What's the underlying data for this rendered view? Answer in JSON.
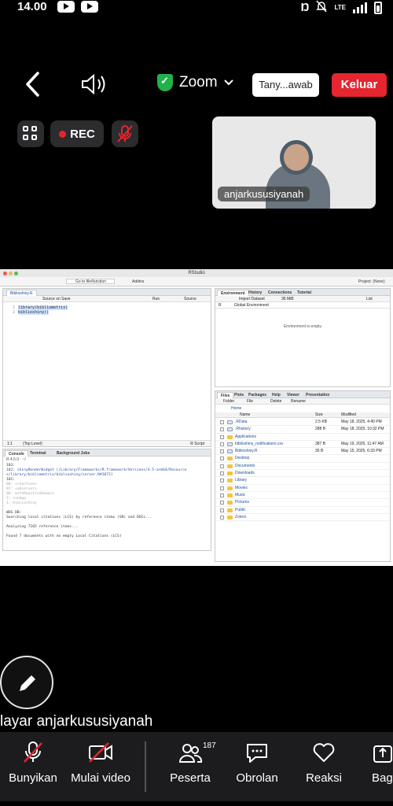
{
  "status_bar": {
    "time": "14.00",
    "network": "LTE"
  },
  "top_bar": {
    "audio_label": "Zoom",
    "ask_button": "Tany...awab",
    "leave_button": "Keluar",
    "rec_label": "REC"
  },
  "video": {
    "participant_name": "anjarkususiyanah"
  },
  "rstudio": {
    "window_title": "RStudio",
    "toolbar": {
      "goto": "Go to file/function",
      "addins": "Addins",
      "project": "Project: (None)"
    },
    "editor": {
      "tab": "Biblioshiny.R",
      "source_on_save": "Source on Save",
      "run": "Run",
      "source": "Source",
      "line_numbers": [
        "1",
        "2"
      ],
      "lines": [
        "library(bibliometrix)",
        "biblioshiny()"
      ],
      "status_pos": "1:1",
      "status_scope": "(Top Level)",
      "status_type": "R Script"
    },
    "console": {
      "tabs": [
        "Console",
        "Terminal",
        "Background Jobs"
      ],
      "path": "R 4.5.0 · ~/",
      "lines": [
        "103:",
        "102: shinyRenderWidget [/Library/Frameworks/R.framework/Versions/4.5-arm64/Resource",
        "s/library/bibliometrix/biblioshiny/server.R#3872]",
        "101:",
        "88: <reactive>",
        "87: <observer>",
        "86: withReactiveDomain",
        "2: runApp",
        "1: biblioshiny",
        "",
        "WOS DB:",
        "Searching local citations (LCS) by reference items (SR) and DOIs...",
        "",
        "Analyzing 7165 reference items...",
        "",
        "Found 7 documents with no empty Local Citations (LCS)"
      ]
    },
    "environment": {
      "tabs": [
        "Environment",
        "History",
        "Connections",
        "Tutorial"
      ],
      "import": "Import Dataset",
      "memory": "36 MiB",
      "list": "List",
      "lang": "R",
      "scope": "Global Environment",
      "empty_msg": "Environment is empty"
    },
    "files": {
      "tabs": [
        "Files",
        "Plots",
        "Packages",
        "Help",
        "Viewer",
        "Presentation"
      ],
      "toolbar": [
        "Folder",
        "File",
        "Delete",
        "Rename"
      ],
      "breadcrumb": "Home",
      "headers": [
        "Name",
        "Size",
        "Modified"
      ],
      "rows": [
        {
          "name": ".RData",
          "size": "2.5 KB",
          "modified": "May 18, 2025, 4:40 PM",
          "folder": false
        },
        {
          "name": ".Rhistory",
          "size": "288 B",
          "modified": "May 18, 2025, 10:32 PM",
          "folder": false
        },
        {
          "name": "Applications",
          "size": "",
          "modified": "",
          "folder": true
        },
        {
          "name": "biblioshiny_notifications.csv",
          "size": "387 B",
          "modified": "May 19, 2025, 11:47 AM",
          "folder": false
        },
        {
          "name": "Biblioshiny.R",
          "size": "35 B",
          "modified": "May 15, 2025, 6:33 PM",
          "folder": false
        },
        {
          "name": "Desktop",
          "size": "",
          "modified": "",
          "folder": true
        },
        {
          "name": "Documents",
          "size": "",
          "modified": "",
          "folder": true
        },
        {
          "name": "Downloads",
          "size": "",
          "modified": "",
          "folder": true
        },
        {
          "name": "Library",
          "size": "",
          "modified": "",
          "folder": true
        },
        {
          "name": "Movies",
          "size": "",
          "modified": "",
          "folder": true
        },
        {
          "name": "Music",
          "size": "",
          "modified": "",
          "folder": true
        },
        {
          "name": "Pictures",
          "size": "",
          "modified": "",
          "folder": true
        },
        {
          "name": "Public",
          "size": "",
          "modified": "",
          "folder": true
        },
        {
          "name": "Zotero",
          "size": "",
          "modified": "",
          "folder": true
        }
      ]
    }
  },
  "presenter": {
    "label": "layar anjarkususiyanah"
  },
  "bottom_bar": {
    "items": [
      "Bunyikan",
      "Mulai video",
      "Peserta",
      "Obrolan",
      "Reaksi",
      "Bagi"
    ],
    "participant_count": "187"
  },
  "colors": {
    "leave": "#e5252f",
    "shield": "#21b24a",
    "bar_bg": "#1c1c1e"
  }
}
